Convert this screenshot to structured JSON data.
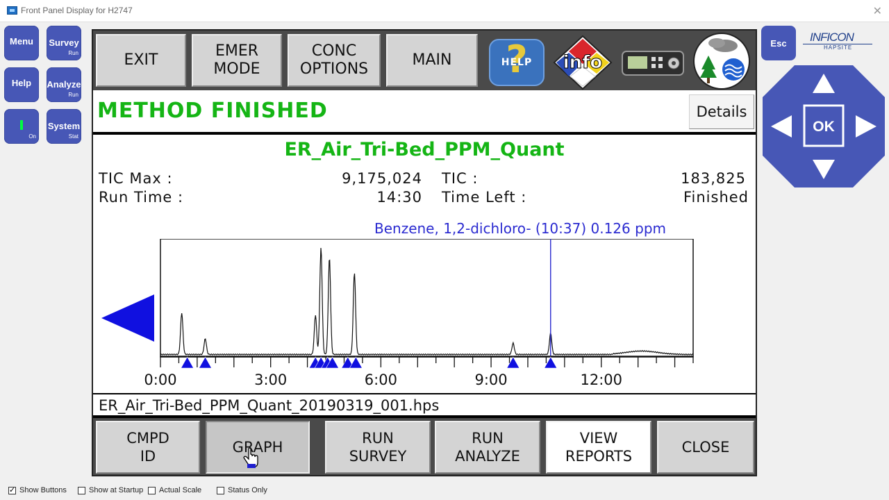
{
  "window": {
    "title": "Front Panel Display for H2747",
    "close_glyph": "✕"
  },
  "left_buttons": [
    {
      "label": "Menu",
      "sub": ""
    },
    {
      "label": "Survey",
      "sub": "Run"
    },
    {
      "label": "Help",
      "sub": ""
    },
    {
      "label": "Analyze",
      "sub": "Run"
    },
    {
      "label": "",
      "sub": "On"
    },
    {
      "label": "System",
      "sub": "Stat"
    }
  ],
  "top_buttons": {
    "exit": "EXIT",
    "emer": "EMER\nMODE",
    "conc": "CONC\nOPTIONS",
    "main": "MAIN"
  },
  "icons": {
    "help_text": "HELP",
    "help_glyph": "?",
    "info_text": "info"
  },
  "status": {
    "text": "METHOD FINISHED",
    "details": "Details"
  },
  "run": {
    "method": "ER_Air_Tri-Bed_PPM_Quant",
    "tic_max_label": "TIC Max :",
    "tic_max_value": "9,175,024",
    "tic_label": "TIC :",
    "tic_value": "183,825",
    "run_time_label": "Run Time :",
    "run_time_value": "14:30",
    "time_left_label": "Time Left :",
    "time_left_value": "Finished"
  },
  "chart_data": {
    "type": "line",
    "title": "",
    "xlabel": "",
    "ylabel": "",
    "x_unit": "minutes",
    "xlim": [
      0,
      14.5
    ],
    "ylim": [
      0,
      1
    ],
    "tick_labels": [
      "0:00",
      "3:00",
      "6:00",
      "9:00",
      "12:00"
    ],
    "tick_values": [
      0,
      3,
      6,
      9,
      12
    ],
    "selected_peak": {
      "label": "Benzene, 1,2-dichloro- (10:37) 0.126 ppm",
      "time": 10.62
    },
    "peaks": [
      {
        "time": 0.58,
        "height": 0.37
      },
      {
        "time": 1.22,
        "height": 0.14
      },
      {
        "time": 4.22,
        "height": 0.35
      },
      {
        "time": 4.37,
        "height": 0.95
      },
      {
        "time": 4.6,
        "height": 0.86
      },
      {
        "time": 5.28,
        "height": 0.73
      },
      {
        "time": 9.6,
        "height": 0.1
      },
      {
        "time": 10.62,
        "height": 0.19
      }
    ],
    "peak_markers": [
      0.73,
      1.22,
      4.22,
      4.37,
      4.55,
      4.68,
      5.1,
      5.32,
      9.6,
      10.62
    ]
  },
  "file": {
    "name": "ER_Air_Tri-Bed_PPM_Quant_20190319_001.hps"
  },
  "bottom_buttons": {
    "cmpd": "CMPD\nID",
    "graph": "GRAPH",
    "run_survey": "RUN\nSURVEY",
    "run_analyze": "RUN\nANALYZE",
    "view_reports": "VIEW\nREPORTS",
    "close": "CLOSE"
  },
  "right": {
    "esc": "Esc",
    "brand": "INFICON",
    "product": "HAPSITE",
    "ok": "OK"
  },
  "options": [
    {
      "label": "Show Buttons",
      "checked": true
    },
    {
      "label": "Show at Startup",
      "checked": false
    },
    {
      "label": "Actual Scale",
      "checked": false
    },
    {
      "label": "Status Only",
      "checked": false
    }
  ]
}
